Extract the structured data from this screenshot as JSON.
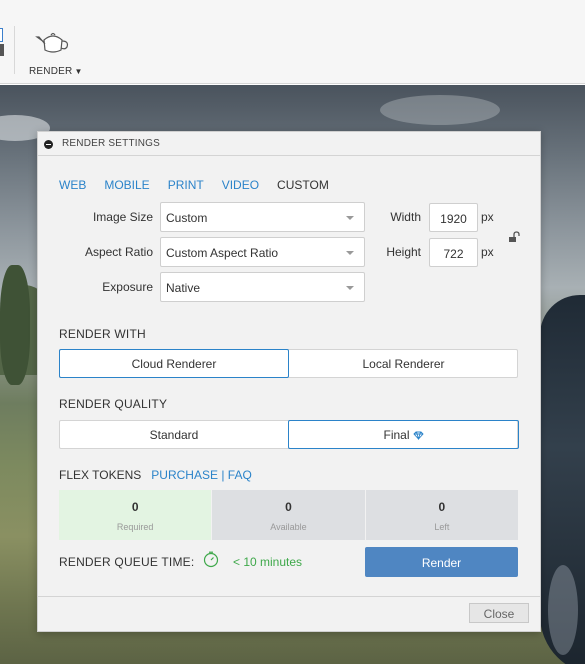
{
  "toolbar": {
    "render_label": "RENDER",
    "icons": [
      "teapot-icon",
      "caret-down-icon"
    ]
  },
  "dialog": {
    "title": "RENDER SETTINGS",
    "tabs": [
      {
        "label": "WEB",
        "active": false
      },
      {
        "label": "MOBILE",
        "active": false
      },
      {
        "label": "PRINT",
        "active": false
      },
      {
        "label": "VIDEO",
        "active": false
      },
      {
        "label": "CUSTOM",
        "active": true
      }
    ],
    "image_size": {
      "label": "Image Size",
      "value": "Custom"
    },
    "aspect_ratio": {
      "label": "Aspect Ratio",
      "value": "Custom Aspect Ratio"
    },
    "exposure": {
      "label": "Exposure",
      "value": "Native"
    },
    "width": {
      "label": "Width",
      "value": "1920",
      "unit": "px"
    },
    "height": {
      "label": "Height",
      "value": "722",
      "unit": "px"
    },
    "render_with": {
      "title": "RENDER WITH",
      "options": [
        "Cloud Renderer",
        "Local Renderer"
      ],
      "selected": "Cloud Renderer"
    },
    "render_quality": {
      "title": "RENDER QUALITY",
      "options": [
        "Standard",
        "Final"
      ],
      "selected": "Final"
    },
    "flex_tokens": {
      "title": "FLEX TOKENS",
      "purchase": "PURCHASE",
      "separator": "|",
      "faq": "FAQ",
      "required": {
        "value": "0",
        "caption": "Required"
      },
      "available": {
        "value": "0",
        "caption": "Available"
      },
      "left": {
        "value": "0",
        "caption": "Left"
      }
    },
    "queue": {
      "label": "RENDER QUEUE TIME:",
      "time": "< 10 minutes"
    },
    "render_button": "Render",
    "close_button": "Close"
  },
  "colors": {
    "accent": "#2b83c9",
    "render_button": "#4f86c2",
    "queue_time": "#3ea84a",
    "required_bg": "#e3f4e2",
    "token_bg": "#dddfe2"
  }
}
